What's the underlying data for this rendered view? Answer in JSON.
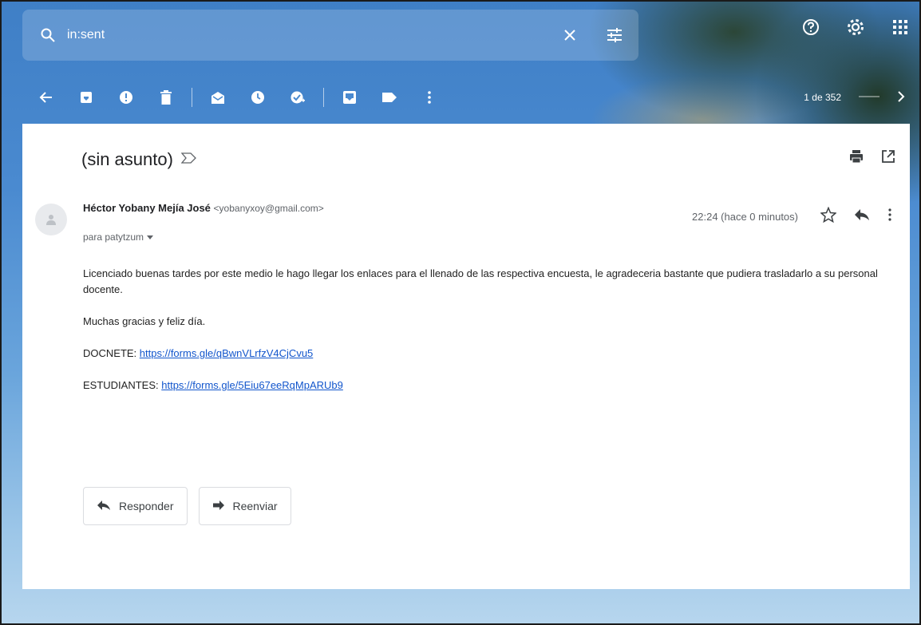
{
  "search": {
    "query": "in:sent"
  },
  "pager": {
    "label": "1 de 352"
  },
  "email": {
    "subject": "(sin asunto)",
    "sender_name": "Héctor Yobany Mejía José",
    "sender_email": "<yobanyxoy@gmail.com>",
    "to_line": "para patytzum",
    "time": "22:24 (hace 0 minutos)",
    "body": {
      "para1": "Licenciado buenas tardes por este medio le hago llegar los enlaces para el llenado de las respectiva encuesta, le agradeceria bastante que pudiera trasladarlo a su personal docente.",
      "para2": "Muchas gracias y feliz día.",
      "link1_label": "DOCNETE:",
      "link1_url": "https://forms.gle/qBwnVLrfzV4CjCvu5",
      "link2_label": "ESTUDIANTES:",
      "link2_url": "https://forms.gle/5Eiu67eeRqMpARUb9"
    }
  },
  "buttons": {
    "reply": "Responder",
    "forward": "Reenviar"
  },
  "icons": [
    "search-icon",
    "clear-icon",
    "search-options-icon",
    "help-icon",
    "settings-icon",
    "apps-icon",
    "back-icon",
    "archive-icon",
    "report-spam-icon",
    "delete-icon",
    "mark-unread-icon",
    "snooze-icon",
    "add-task-icon",
    "move-to-icon",
    "labels-icon",
    "more-icon",
    "next-icon",
    "print-icon",
    "new-window-icon",
    "star-icon",
    "reply-icon",
    "more-vert-icon"
  ]
}
